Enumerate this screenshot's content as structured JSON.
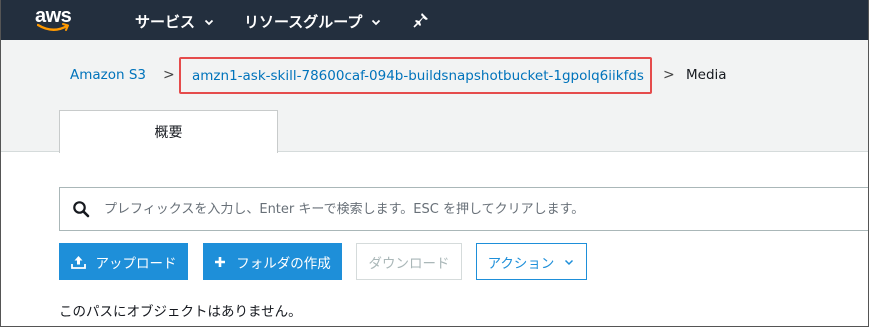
{
  "topnav": {
    "logo_text": "aws",
    "services_label": "サービス",
    "resource_groups_label": "リソースグループ"
  },
  "breadcrumb": {
    "root": "Amazon S3",
    "separator": ">",
    "bucket": "amzn1-ask-skill-78600caf-094b-buildsnapshotbucket-1gpolq6iikfds",
    "current": "Media"
  },
  "tabs": [
    {
      "label": "概要"
    }
  ],
  "search": {
    "placeholder": "プレフィックスを入力し、Enter キーで検索します。ESC を押してクリアします。",
    "value": ""
  },
  "toolbar": {
    "upload_label": "アップロード",
    "create_folder_label": "フォルダの作成",
    "download_label": "ダウンロード",
    "actions_label": "アクション"
  },
  "content": {
    "empty_message": "このパスにオブジェクトはありません。"
  },
  "colors": {
    "nav_bg": "#232f3e",
    "link": "#0073bb",
    "primary": "#1e8fd9",
    "highlight_border": "#e54b4b",
    "logo_smile": "#ff9900"
  }
}
